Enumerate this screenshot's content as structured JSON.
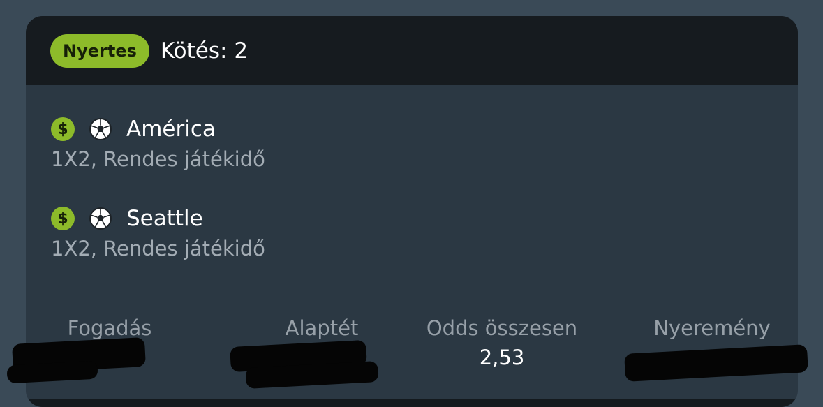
{
  "header": {
    "status_badge": "Nyertes",
    "bet_label": "Kötés: 2"
  },
  "selections": [
    {
      "team": "América",
      "market": "1X2, Rendes játékidő",
      "icons": [
        "dollar-icon",
        "soccer-ball-icon"
      ]
    },
    {
      "team": "Seattle",
      "market": "1X2, Rendes játékidő",
      "icons": [
        "dollar-icon",
        "soccer-ball-icon"
      ]
    }
  ],
  "summary": {
    "bet_label": "Fogadás",
    "stake_label": "Alaptét",
    "odds_label": "Odds összesen",
    "odds_value": "2,53",
    "winnings_label": "Nyeremény"
  },
  "colors": {
    "background": "#3a4a57",
    "card": "#2b3843",
    "header": "#161b1f",
    "accent": "#8dbb2a"
  }
}
